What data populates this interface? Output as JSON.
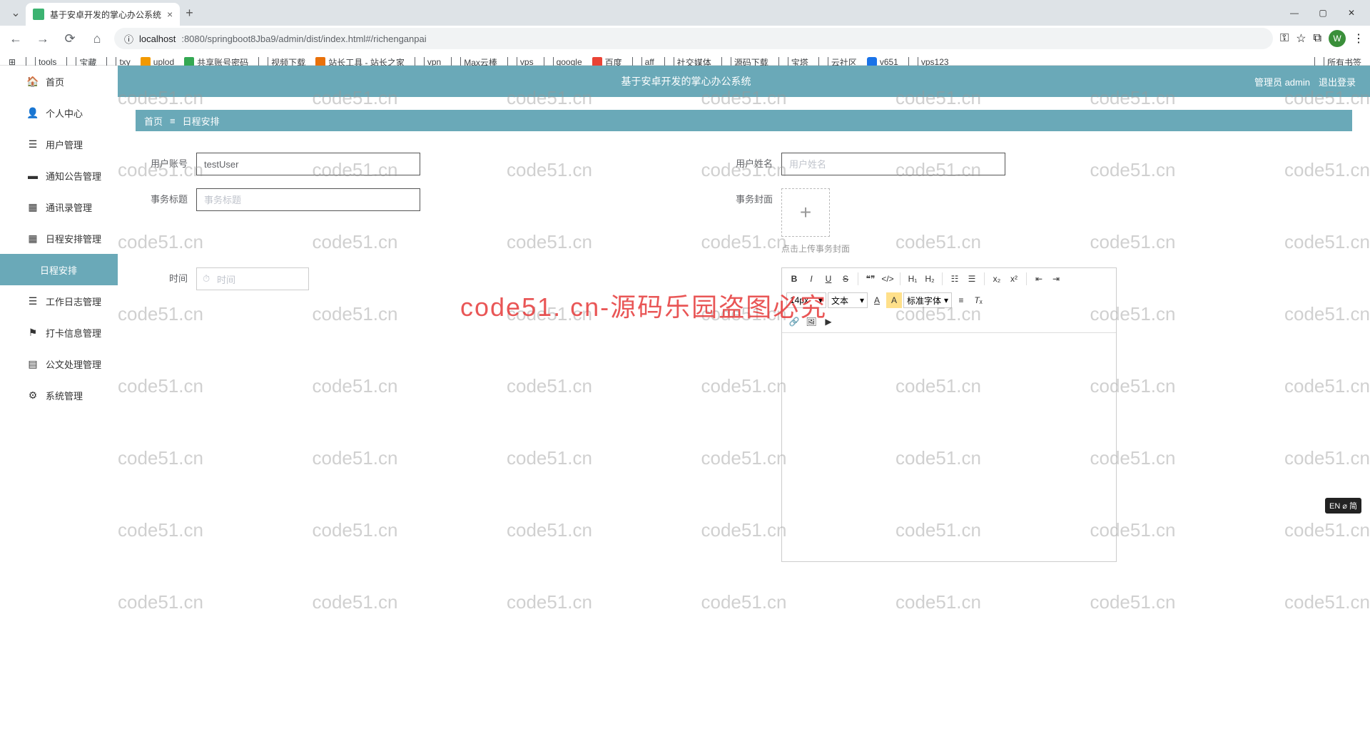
{
  "browser": {
    "tab_title": "基于安卓开发的掌心办公系统",
    "url_host": "localhost",
    "url_path": ":8080/springboot8Jba9/admin/dist/index.html#/richenganpai",
    "bookmarks": [
      "tools",
      "宝藏",
      "txy",
      "uplod",
      "共享账号密码",
      "视频下载",
      "站长工具 - 站长之家",
      "vpn",
      "Max云棒",
      "vps",
      "google",
      "百度",
      "aff",
      "社交媒体",
      "源码下载",
      "宝塔",
      "云社区",
      "v651",
      "vps123"
    ],
    "all_bookmarks": "所有书签",
    "avatar_letter": "W"
  },
  "header": {
    "title": "基于安卓开发的掌心办公系统",
    "user": "管理员 admin",
    "logout": "退出登录"
  },
  "breadcrumb": {
    "home": "首页",
    "current": "日程安排"
  },
  "sidebar": {
    "items": [
      {
        "label": "首页"
      },
      {
        "label": "个人中心"
      },
      {
        "label": "用户管理"
      },
      {
        "label": "通知公告管理"
      },
      {
        "label": "通讯录管理"
      },
      {
        "label": "日程安排管理"
      },
      {
        "label": "日程安排"
      },
      {
        "label": "工作日志管理"
      },
      {
        "label": "打卡信息管理"
      },
      {
        "label": "公文处理管理"
      },
      {
        "label": "系统管理"
      }
    ]
  },
  "form": {
    "user_account": {
      "label": "用户账号",
      "value": "testUser"
    },
    "user_name": {
      "label": "用户姓名",
      "placeholder": "用户姓名",
      "value": ""
    },
    "task_title": {
      "label": "事务标题",
      "placeholder": "事务标题",
      "value": ""
    },
    "task_cover": {
      "label": "事务封面",
      "hint": "点击上传事务封面"
    },
    "time": {
      "label": "时间",
      "placeholder": "时间"
    },
    "editor": {
      "font_size": "14px",
      "font_family": "文本",
      "std_font": "标准字体"
    }
  },
  "watermark": {
    "text": "code51.cn",
    "big": "code51. cn-源码乐园盗图必究"
  },
  "ime": "EN ⌀ 简"
}
